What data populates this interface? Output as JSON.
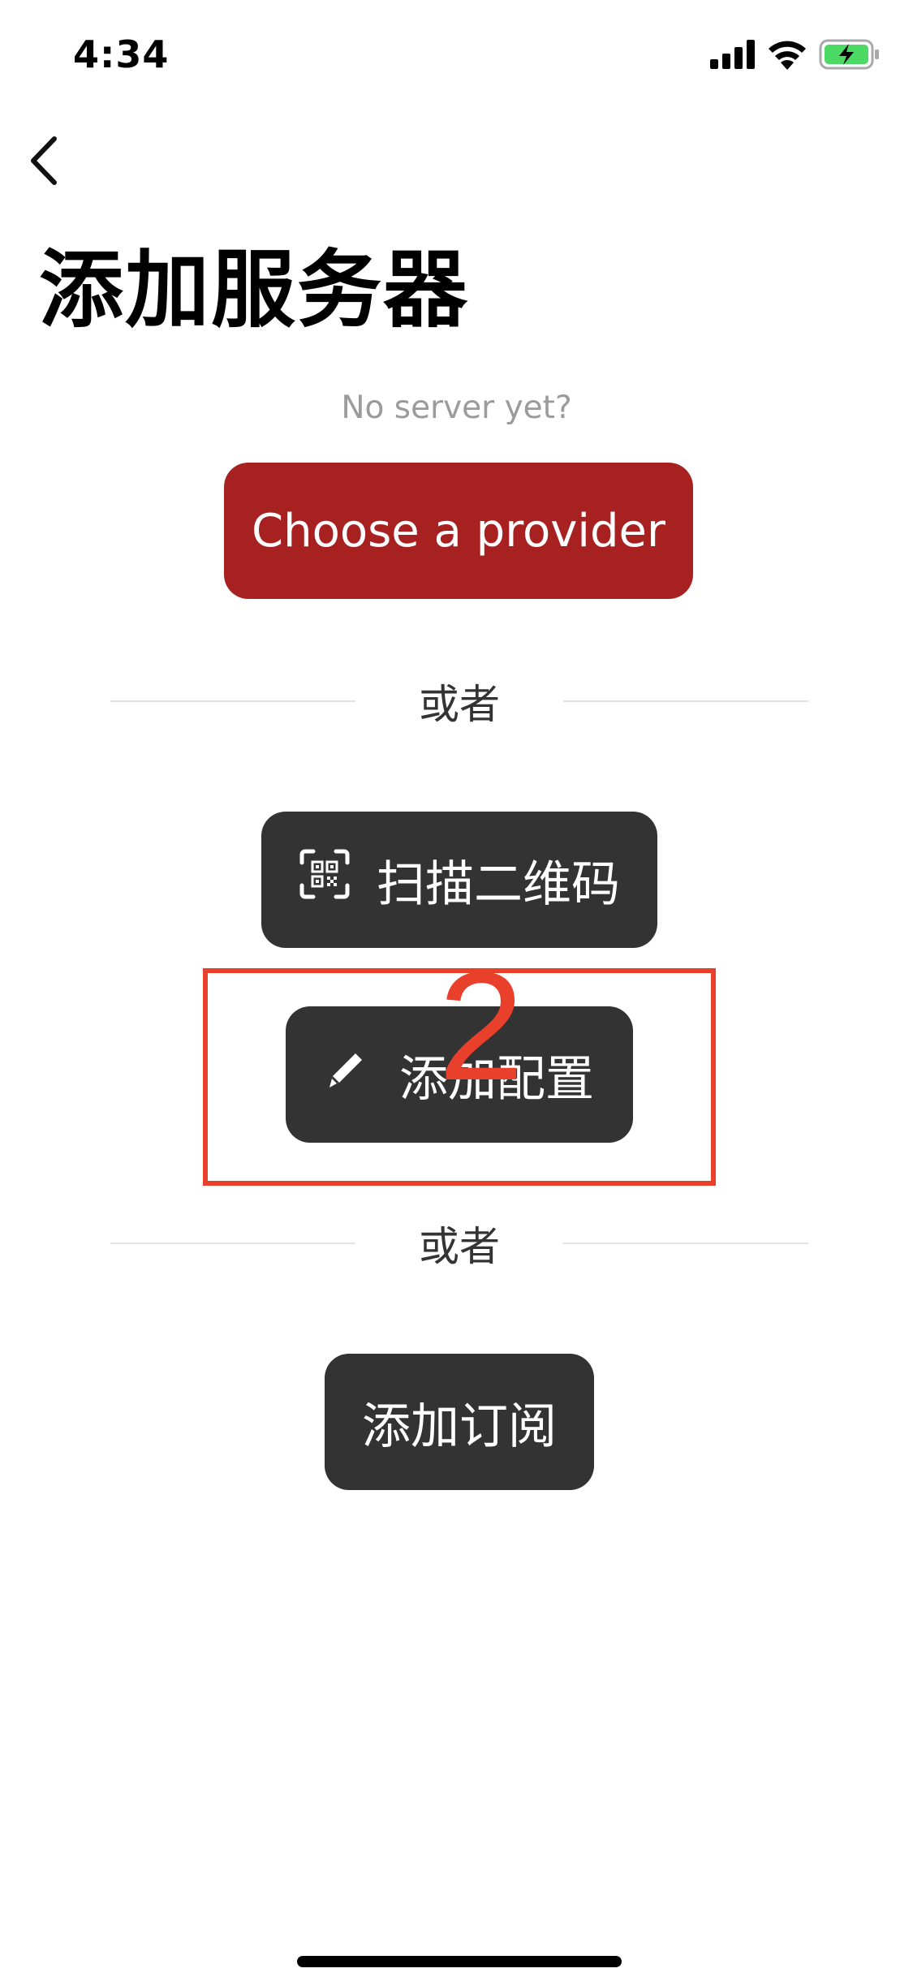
{
  "status_bar": {
    "time": "4:34",
    "icons": [
      "cellular-signal-icon",
      "wifi-icon",
      "battery-charging-icon"
    ]
  },
  "nav": {
    "back_icon": "chevron-left-icon",
    "title": "添加服务器"
  },
  "main": {
    "hint": "No server yet?",
    "provider_button_label": "Choose a provider",
    "divider_label_1": "或者",
    "scan_button_label": "扫描二维码",
    "scan_icon": "qr-scan-icon",
    "config_button_label": "添加配置",
    "config_icon": "pencil-icon",
    "divider_label_2": "或者",
    "subscribe_button_label": "添加订阅"
  },
  "annotation": {
    "number": "2"
  },
  "colors": {
    "provider_button": "#a82121",
    "dark_button": "#333333",
    "annotation": "#e8402a",
    "hint_text": "#9b9b9b",
    "battery": "#4cd964"
  }
}
